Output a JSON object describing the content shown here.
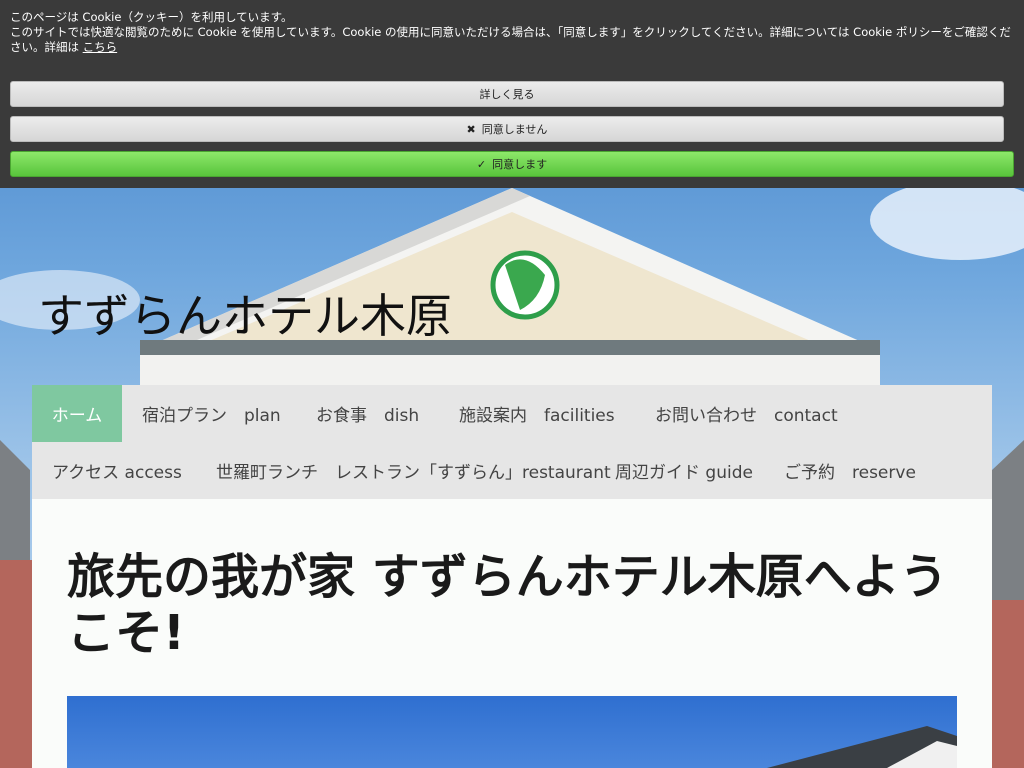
{
  "cookie": {
    "line1": "このページは Cookie（クッキー）を利用しています。",
    "line2": "このサイトでは快適な閲覧のために Cookie を使用しています。Cookie の使用に同意いただける場合は、「同意します」をクリックしてください。詳細については Cookie ポリシーをご確認ください。詳細は ",
    "link": "こちら",
    "more_label": "詳しく見る",
    "deny_label": "同意しません",
    "agree_label": "同意します"
  },
  "site": {
    "title": "すずらんホテル木原"
  },
  "nav": {
    "items": [
      {
        "label": "ホーム",
        "active": true
      },
      {
        "label": "宿泊プラン　plan"
      },
      {
        "label": "お食事　dish"
      },
      {
        "label": "施設案内　facilities"
      },
      {
        "label": "お問い合わせ　contact"
      },
      {
        "label": "アクセス access"
      },
      {
        "label": "世羅町ランチ　レストラン「すずらん」restaurant"
      },
      {
        "label": "周辺ガイド guide"
      },
      {
        "label": "ご予約　reserve"
      }
    ]
  },
  "main": {
    "headline": "旅先の我が家 すずらんホテル木原へようこそ!"
  },
  "colors": {
    "nav_active": "#7fc8a0",
    "agree_button": "#58c43b",
    "banner_bg": "#3a3a3a"
  }
}
